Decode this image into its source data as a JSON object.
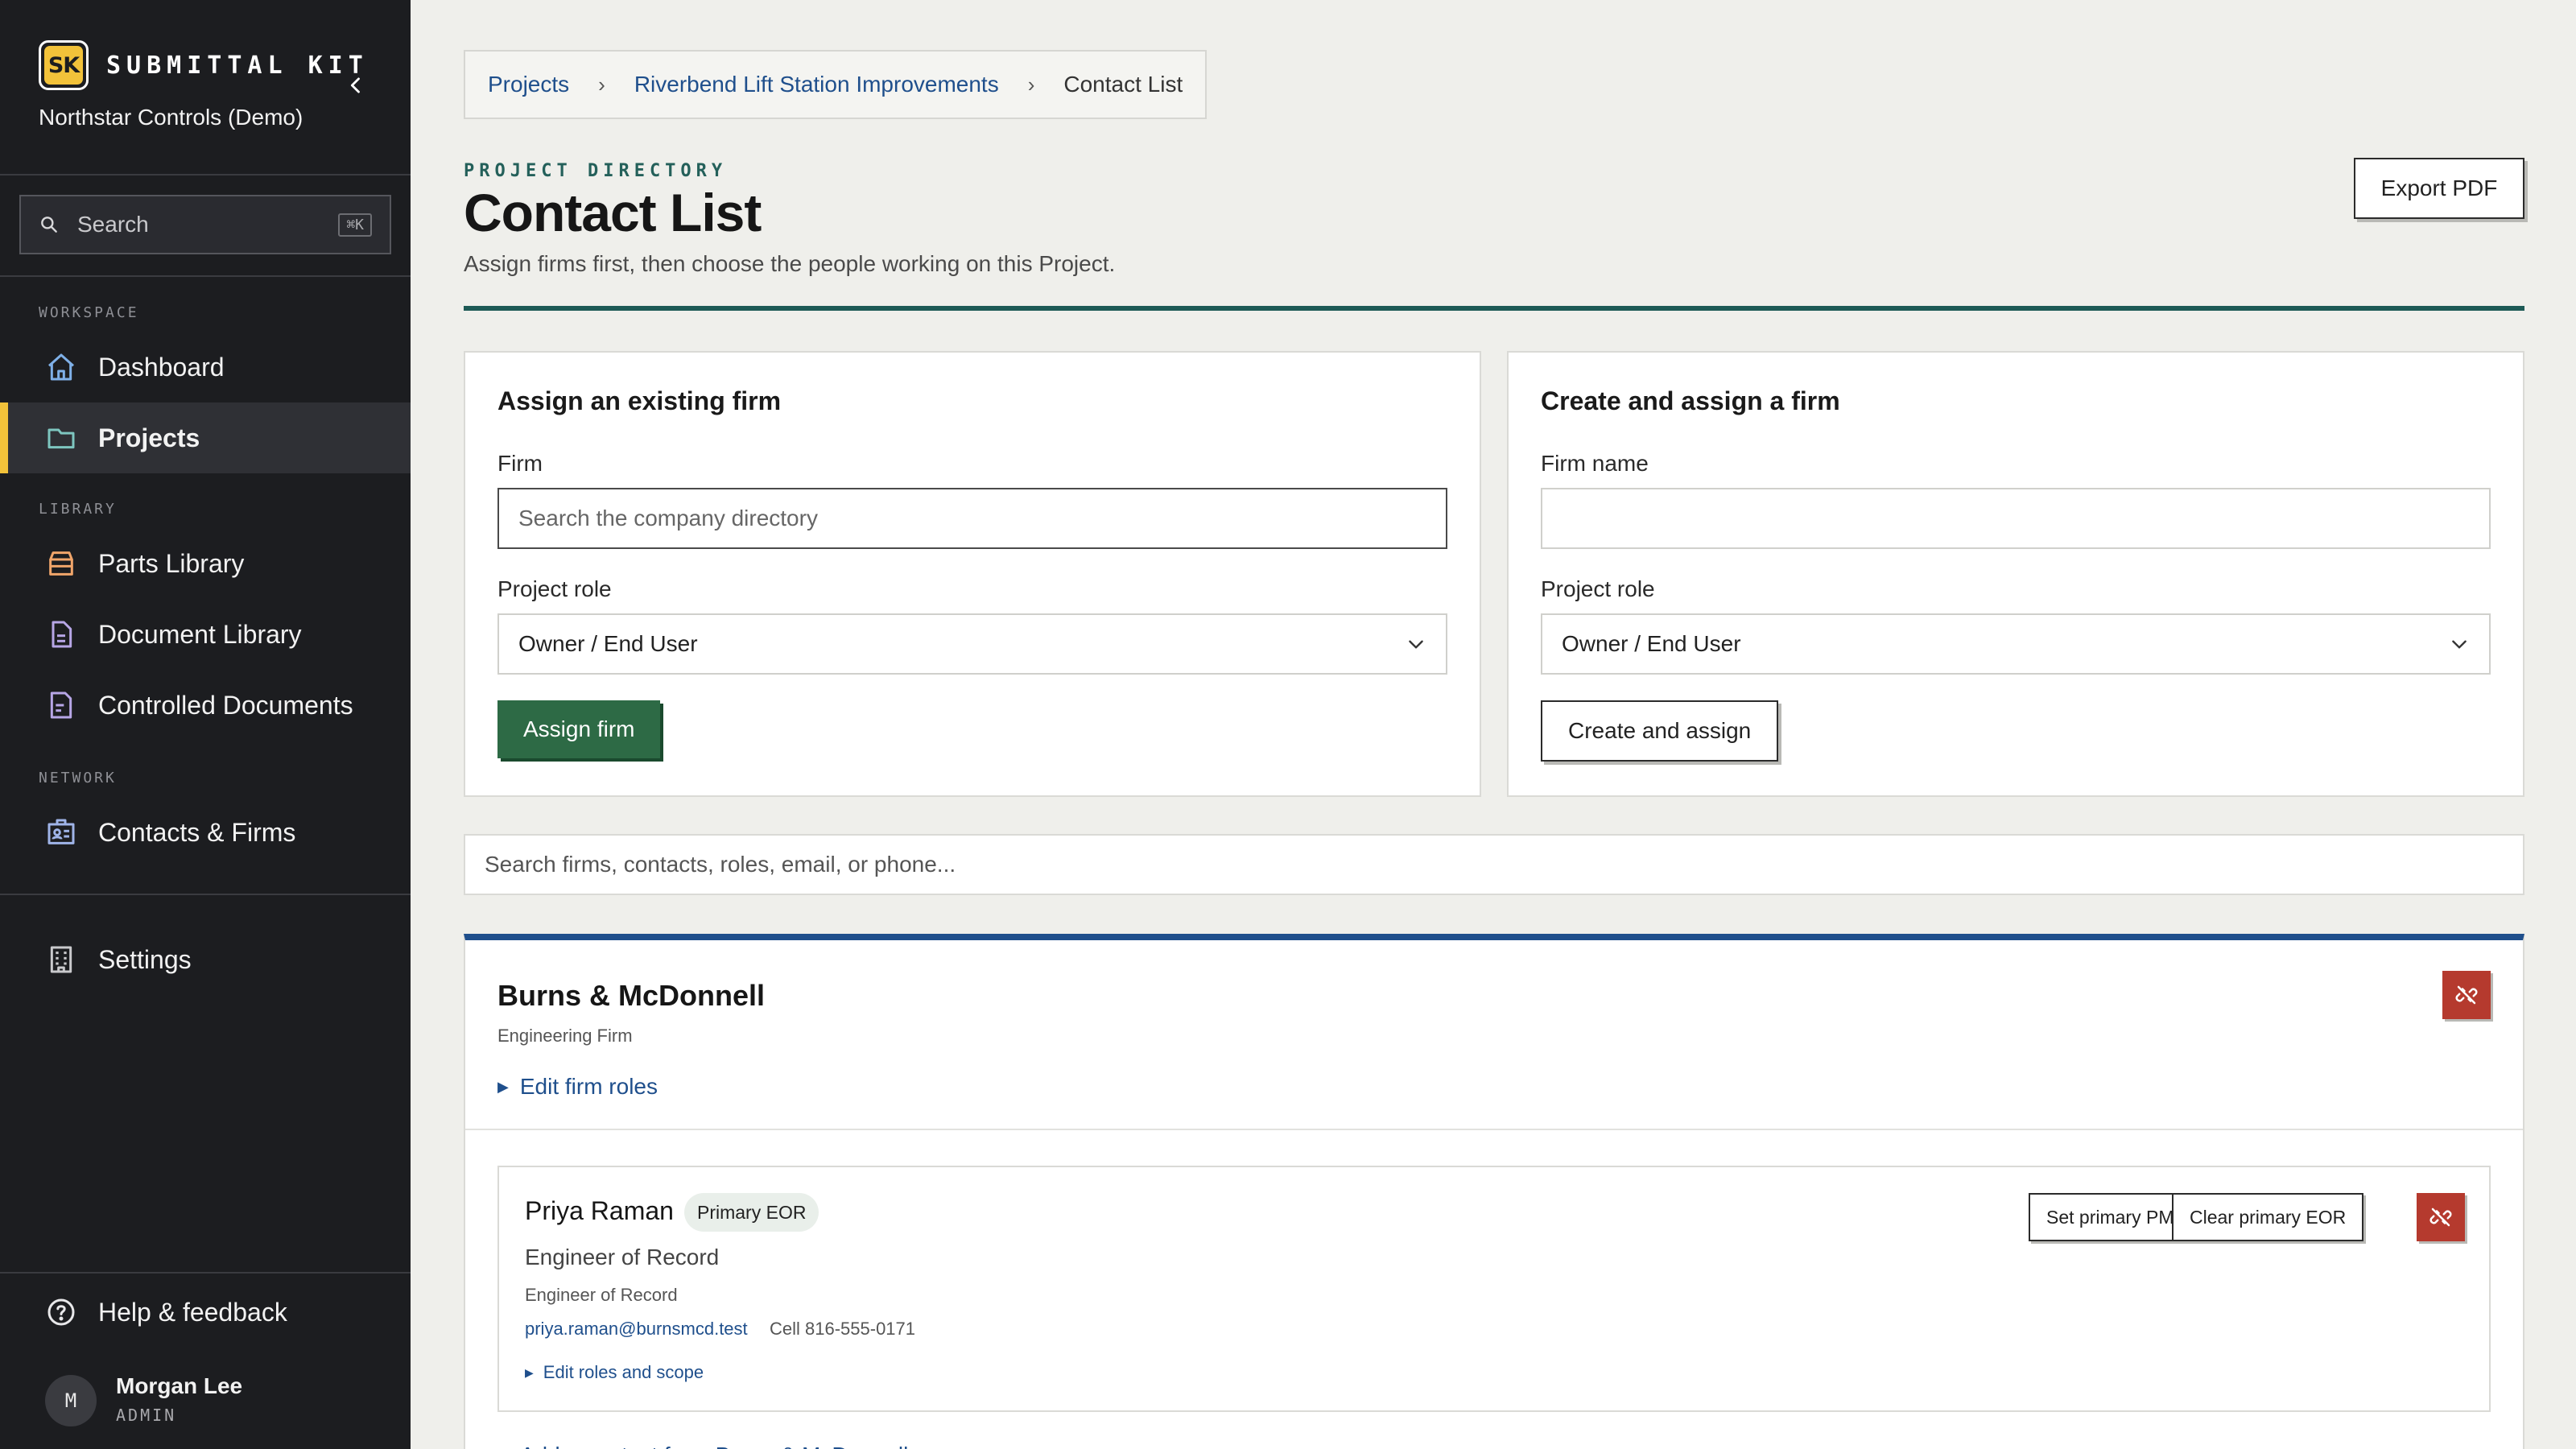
{
  "app": {
    "brand_mark": "SK",
    "brand_name": "SUBMITTAL KIT",
    "org_name": "Northstar Controls (Demo)"
  },
  "sidebar": {
    "search_placeholder": "Search",
    "search_shortcut": "⌘K",
    "sections": {
      "workspace": "WORKSPACE",
      "library": "LIBRARY",
      "network": "NETWORK"
    },
    "items": [
      {
        "label": "Dashboard",
        "icon": "home-icon"
      },
      {
        "label": "Projects",
        "icon": "folder-icon",
        "active": true
      },
      {
        "label": "Parts Library",
        "icon": "box-icon"
      },
      {
        "label": "Document Library",
        "icon": "document-icon"
      },
      {
        "label": "Controlled Documents",
        "icon": "controlled-document-icon"
      },
      {
        "label": "Contacts & Firms",
        "icon": "contact-card-icon"
      },
      {
        "label": "Settings",
        "icon": "building-icon"
      }
    ],
    "help_label": "Help & feedback",
    "user": {
      "initial": "M",
      "name": "Morgan Lee",
      "role": "ADMIN"
    }
  },
  "breadcrumb": {
    "items": [
      "Projects",
      "Riverbend Lift Station Improvements"
    ],
    "current": "Contact List",
    "separator": "›"
  },
  "header": {
    "eyebrow": "PROJECT DIRECTORY",
    "title": "Contact List",
    "subtitle": "Assign firms first, then choose the people working on this Project.",
    "export_label": "Export PDF"
  },
  "assign_existing": {
    "title": "Assign an existing firm",
    "firm_label": "Firm",
    "firm_placeholder": "Search the company directory",
    "role_label": "Project role",
    "role_value": "Owner / End User",
    "button_label": "Assign firm"
  },
  "create_firm": {
    "title": "Create and assign a firm",
    "firm_label": "Firm name",
    "firm_value": "",
    "role_label": "Project role",
    "role_value": "Owner / End User",
    "button_label": "Create and assign"
  },
  "filter": {
    "placeholder": "Search firms, contacts, roles, email, or phone..."
  },
  "firm": {
    "name": "Burns & McDonnell",
    "type": "Engineering Firm",
    "edit_roles_label": "Edit firm roles",
    "accent_color": "#1f4f8c",
    "contacts": [
      {
        "name": "Priya Raman",
        "badge": "Primary EOR",
        "title": "Engineer of Record",
        "role": "Engineer of Record",
        "email": "priya.raman@burnsmcd.test",
        "phone": "Cell 816-555-0171",
        "edit_label": "Edit roles and scope",
        "actions": [
          "Set primary PM",
          "Clear primary EOR"
        ]
      }
    ],
    "add_contact_label": "Add a contact from Burns & McDonnell"
  },
  "colors": {
    "sidebar_bg": "#1c1d20",
    "accent_yellow": "#f2c23a",
    "primary_green": "#2d6a45",
    "danger_red": "#b53a2e",
    "link_blue": "#1f4f8c",
    "title_rule": "#1d5a55"
  }
}
